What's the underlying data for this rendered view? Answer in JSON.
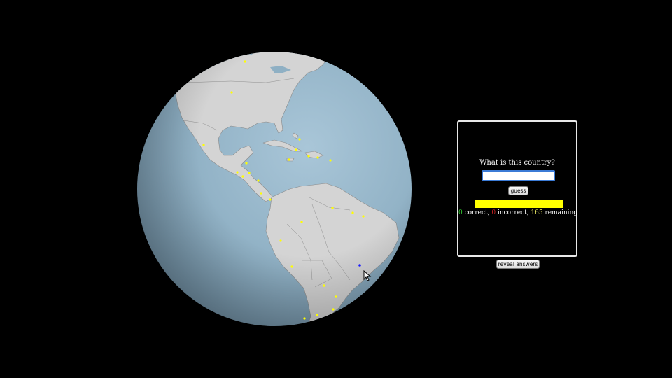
{
  "quiz": {
    "question": "What is this country?",
    "input_value": "",
    "input_placeholder": "",
    "guess_label": "guess",
    "progress_fraction": 1.0,
    "progress_color": "#ffff00",
    "correct_count": "0",
    "correct_suffix": " correct, ",
    "incorrect_count": "0",
    "incorrect_suffix": " incorrect, ",
    "remaining_count": "165",
    "remaining_suffix": " remaining",
    "reveal_label": "reveal answers"
  },
  "colors": {
    "ocean": "#8fb0c4",
    "land": "#d3d3d3",
    "marker": "#ffff00",
    "selected_marker": "#1a1aff",
    "background": "#000000"
  },
  "globe": {
    "icons": {
      "marker": "country-marker-icon",
      "selected": "selected-country-marker-icon",
      "cursor": "mouse-cursor-icon"
    }
  }
}
